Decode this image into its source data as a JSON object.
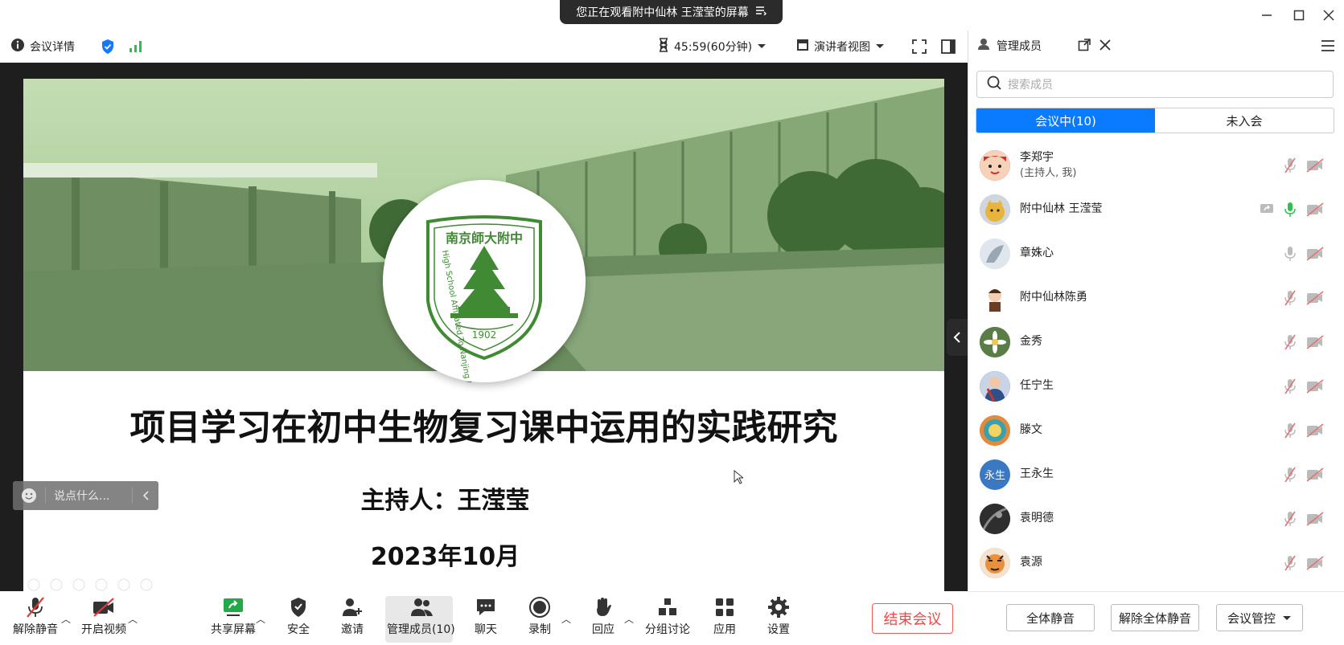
{
  "share_banner": {
    "text": "您正在观看附中仙林 王滢莹的屏幕",
    "icon": "list-icon"
  },
  "window_controls": [
    "minimize-icon",
    "maximize-icon",
    "close-icon"
  ],
  "toolbar": {
    "meeting_info_label": "会议详情",
    "timer_label": "45:59(60分钟)",
    "view_label": "演讲者视图"
  },
  "slide": {
    "emblem_top_text": "南京師大附中",
    "emblem_ring_text": "High School Affiliated To Nanjing Normal University",
    "emblem_year": "1902",
    "title": "项目学习在初中生物复习课中运用的实践研究",
    "host": "主持人：王滢莹",
    "date": "2023年10月"
  },
  "chat": {
    "placeholder": "说点什么..."
  },
  "controls": {
    "unmute": "解除静音",
    "start_video": "开启视频",
    "share_screen": "共享屏幕",
    "security": "安全",
    "invite": "邀请",
    "manage_members": "管理成员(10)",
    "chat": "聊天",
    "record": "录制",
    "reactions": "回应",
    "breakout": "分组讨论",
    "apps": "应用",
    "settings": "设置",
    "end_meeting": "结束会议"
  },
  "panel": {
    "title": "管理成员",
    "search_placeholder": "搜索成员",
    "tab_in_meeting": "会议中(10)",
    "tab_not_joined": "未入会",
    "members": [
      {
        "name": "李郑宇",
        "sub": "(主持人, 我)",
        "avatar_color": "#d94a3a",
        "mic": "muted"
      },
      {
        "name": "附中仙林 王滢莹",
        "sub": "",
        "avatar_color": "#d9a441",
        "mic": "active",
        "sharing": true
      },
      {
        "name": "章姝心",
        "sub": "",
        "avatar_color": "#b8c2cc",
        "mic": "on"
      },
      {
        "name": "附中仙林陈勇",
        "sub": "",
        "avatar_color": "#f2e9e4",
        "mic": "muted"
      },
      {
        "name": "金秀",
        "sub": "",
        "avatar_color": "#4f7a3a",
        "mic": "muted"
      },
      {
        "name": "任宁生",
        "sub": "",
        "avatar_color": "#3c5a8c",
        "mic": "muted"
      },
      {
        "name": "滕文",
        "sub": "",
        "avatar_color": "#3aa0b0",
        "mic": "muted"
      },
      {
        "name": "王永生",
        "sub": "",
        "avatar_text": "永生",
        "avatar_color": "#3b78c4",
        "mic": "muted"
      },
      {
        "name": "袁明德",
        "sub": "",
        "avatar_color": "#444444",
        "mic": "muted"
      },
      {
        "name": "袁源",
        "sub": "",
        "avatar_color": "#e0a060",
        "mic": "muted"
      }
    ],
    "mute_all": "全体静音",
    "unmute_all": "解除全体静音",
    "meeting_control": "会议管控"
  },
  "colors": {
    "accent": "#0a7bff",
    "end": "#f04848",
    "mic_active": "#2fbf4f",
    "slide_green": "#3f8a33"
  }
}
